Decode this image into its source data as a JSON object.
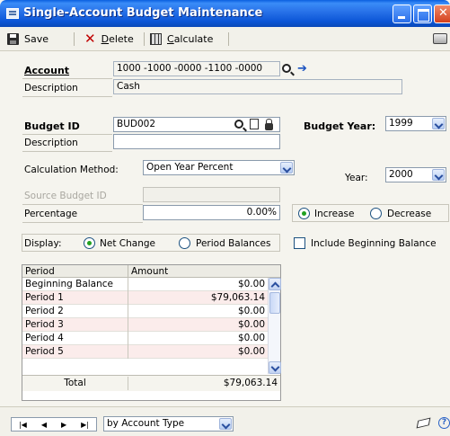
{
  "window": {
    "title": "Single-Account Budget Maintenance"
  },
  "toolbar": {
    "save_label": "Save",
    "delete_label": "Delete",
    "calculate_label": "Calculate"
  },
  "account": {
    "label": "Account",
    "value": "1000 -1000 -0000 -1100 -0000",
    "description_label": "Description",
    "description_value": "Cash"
  },
  "budget": {
    "id_label": "Budget ID",
    "id_value": "BUD002",
    "description_label": "Description",
    "description_value": "",
    "year_label": "Budget Year:",
    "year_value": "1999"
  },
  "calculation": {
    "method_label": "Calculation Method:",
    "method_value": "Open Year Percent",
    "year_label": "Year:",
    "year_value": "2000",
    "source_label": "Source Budget ID",
    "source_value": "",
    "percentage_label": "Percentage",
    "percentage_value": "0.00%",
    "increase_label": "Increase",
    "decrease_label": "Decrease",
    "increase_selected": true
  },
  "display": {
    "label": "Display:",
    "net_change_label": "Net Change",
    "period_balances_label": "Period Balances",
    "net_change_selected": true,
    "include_beginning_label": "Include Beginning Balance",
    "include_beginning_checked": false
  },
  "grid": {
    "headers": {
      "period": "Period",
      "amount": "Amount"
    },
    "rows": [
      {
        "period": "Beginning Balance",
        "amount": "$0.00"
      },
      {
        "period": "Period 1",
        "amount": "$79,063.14"
      },
      {
        "period": "Period 2",
        "amount": "$0.00"
      },
      {
        "period": "Period 3",
        "amount": "$0.00"
      },
      {
        "period": "Period 4",
        "amount": "$0.00"
      },
      {
        "period": "Period 5",
        "amount": "$0.00"
      }
    ],
    "total_label": "Total",
    "total_value": "$79,063.14"
  },
  "bottom": {
    "sort_value": "by Account Type"
  },
  "icons": {
    "window": "window-icon",
    "save": "save-icon",
    "delete": "delete-x-icon",
    "calculate": "calculator-icon",
    "print": "print-icon",
    "lookup": "magnifier-icon",
    "expand": "arrow-right-icon",
    "new": "new-document-icon",
    "lock": "lock-icon",
    "note": "eraser-note-icon",
    "help": "help-icon"
  },
  "colors": {
    "titlebar": "#2a74ea",
    "close_button": "#d3401e",
    "window_bg": "#f5f4ee",
    "alt_row": "#fbeceb",
    "radio_dot": "#21a121"
  }
}
